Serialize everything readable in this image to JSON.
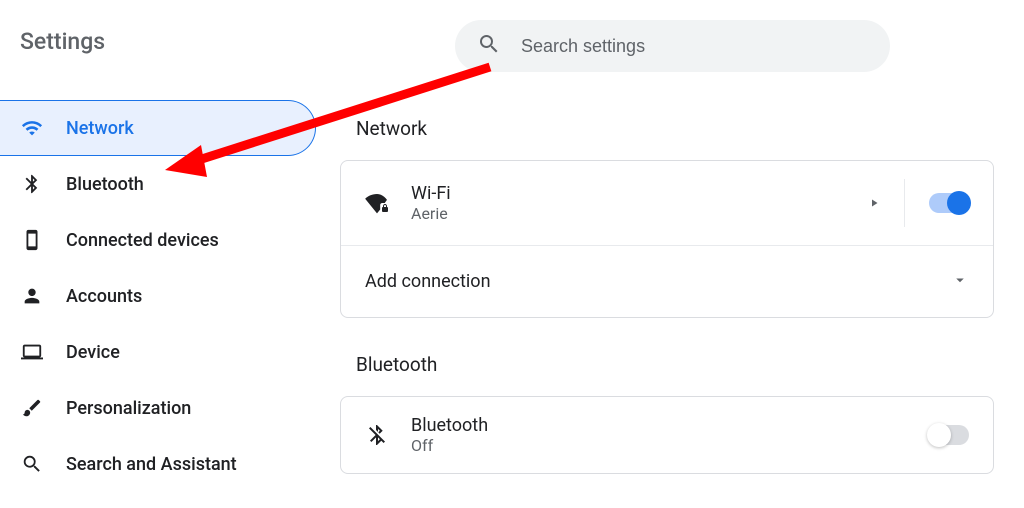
{
  "sidebar": {
    "title": "Settings",
    "items": [
      {
        "label": "Network"
      },
      {
        "label": "Bluetooth"
      },
      {
        "label": "Connected devices"
      },
      {
        "label": "Accounts"
      },
      {
        "label": "Device"
      },
      {
        "label": "Personalization"
      },
      {
        "label": "Search and Assistant"
      }
    ]
  },
  "search": {
    "placeholder": "Search settings"
  },
  "sections": {
    "network": {
      "title": "Network",
      "wifi": {
        "title": "Wi-Fi",
        "subtitle": "Aerie"
      },
      "add_connection": "Add connection"
    },
    "bluetooth": {
      "title": "Bluetooth",
      "row": {
        "title": "Bluetooth",
        "subtitle": "Off"
      }
    }
  }
}
